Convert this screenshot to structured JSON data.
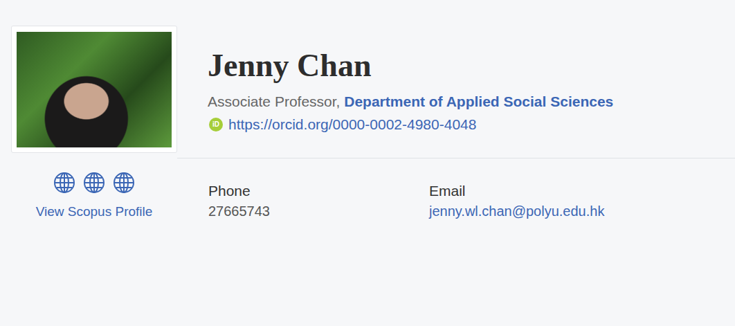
{
  "profile": {
    "name": "Jenny Chan",
    "position": "Associate Professor, ",
    "department": "Department of Applied Social Sciences",
    "orcid_badge": "iD",
    "orcid_url": "https://orcid.org/0000-0002-4980-4048"
  },
  "scopus_link": "View Scopus Profile",
  "contacts": [
    {
      "label": "Phone",
      "value": "27665743",
      "kind": "text"
    },
    {
      "label": "Email",
      "value": "jenny.wl.chan@polyu.edu.hk",
      "kind": "link"
    }
  ]
}
